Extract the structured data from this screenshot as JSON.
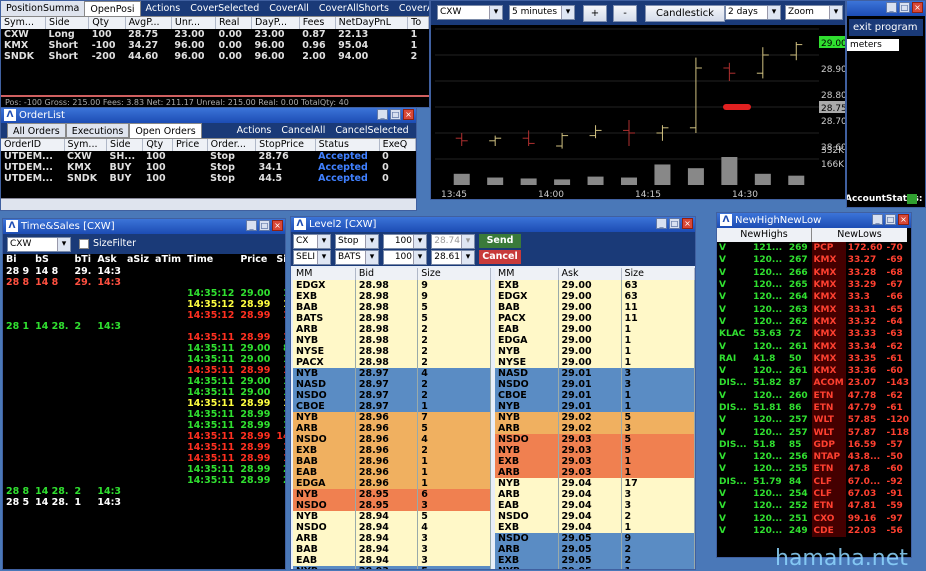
{
  "position": {
    "tabs": [
      "PositionSumma",
      "OpenPosi",
      "Actions",
      "CoverSelected",
      "CoverAll",
      "CoverAllShorts",
      "CoverAllLongs"
    ],
    "headers": [
      "Sym...",
      "Side",
      "Qty",
      "AvgP...",
      "Unr...",
      "Real",
      "DayP...",
      "Fees",
      "NetDayPnL",
      "To"
    ],
    "rows": [
      [
        "CXW",
        "Long",
        "100",
        "28.75",
        "23.00",
        "0.00",
        "23.00",
        "0.87",
        "22.13",
        "1"
      ],
      [
        "KMX",
        "Short",
        "-100",
        "34.27",
        "96.00",
        "0.00",
        "96.00",
        "0.96",
        "95.04",
        "1"
      ],
      [
        "SNDK",
        "Short",
        "-200",
        "44.60",
        "96.00",
        "0.00",
        "96.00",
        "2.00",
        "94.00",
        "2"
      ]
    ],
    "footer": "Pos:   -100  Gross:  215.00  Fees:   3.83   Net:  211.17   Unreal:  215.00   Real:   0.00   TotalQty:   40"
  },
  "orders": {
    "title": "OrderList",
    "tabs": [
      "All Orders",
      "Executions",
      "Open Orders",
      "Actions",
      "CancelAll",
      "CancelSelected"
    ],
    "headers": [
      "OrderID",
      "Sym...",
      "Side",
      "Qty",
      "Price",
      "Order...",
      "StopPrice",
      "Status",
      "ExeQ"
    ],
    "rows": [
      [
        "UTDEM...",
        "CXW",
        "SH...",
        "100",
        "",
        "Stop",
        "28.76",
        "Accepted",
        "0"
      ],
      [
        "UTDEM...",
        "KMX",
        "BUY",
        "100",
        "",
        "Stop",
        "34.1",
        "Accepted",
        "0"
      ],
      [
        "UTDEM...",
        "SNDK",
        "BUY",
        "100",
        "",
        "Stop",
        "44.5",
        "Accepted",
        "0"
      ]
    ]
  },
  "chart": {
    "symbol": "CXW",
    "interval": "5 minutes",
    "style": "Candlestick",
    "range": "2 days",
    "zoom": "Zoom",
    "plus": "+",
    "minus": "-",
    "y_labels": [
      "29.00",
      "28.90",
      "28.80",
      "28.75",
      "28.70",
      "28.60",
      "332K",
      "166K"
    ],
    "x_labels": [
      "13:45",
      "14:00",
      "14:15",
      "14:30"
    ]
  },
  "chart_data": {
    "type": "candlestick",
    "x": [
      "13:45",
      "13:50",
      "13:55",
      "14:00",
      "14:05",
      "14:10",
      "14:15",
      "14:20",
      "14:25",
      "14:30",
      "14:35"
    ],
    "ylim": [
      28.55,
      29.05
    ],
    "ohlc": [
      [
        28.63,
        28.65,
        28.6,
        28.62
      ],
      [
        28.62,
        28.64,
        28.6,
        28.63
      ],
      [
        28.63,
        28.66,
        28.6,
        28.61
      ],
      [
        28.6,
        28.65,
        28.59,
        28.64
      ],
      [
        28.64,
        28.68,
        28.63,
        28.66
      ],
      [
        28.66,
        28.7,
        28.6,
        28.65
      ],
      [
        28.65,
        28.68,
        28.62,
        28.67
      ],
      [
        28.67,
        28.94,
        28.65,
        28.9
      ],
      [
        28.9,
        28.92,
        28.85,
        28.88
      ],
      [
        28.88,
        28.98,
        28.86,
        28.95
      ],
      [
        28.95,
        29.0,
        28.93,
        28.99
      ]
    ],
    "volume": [
      60,
      40,
      35,
      30,
      45,
      40,
      110,
      90,
      150,
      60,
      50
    ]
  },
  "exitp": {
    "title": "exit program",
    "meters": "meters",
    "status": "AccountStatus:"
  },
  "ts": {
    "title": "Time&Sales [CXW]",
    "symbol": "CXW",
    "sizefilter": "SizeFilter",
    "headers": [
      "Bi",
      "bS",
      "bTi",
      "Ask",
      "aSiz",
      "aTim",
      "Time",
      "Price",
      "Size"
    ],
    "quote1": [
      "28 9",
      "14 8",
      "29.",
      "14:3"
    ],
    "quote1b": [
      "28 8",
      "14 8",
      "29.",
      "14:3"
    ],
    "trades": [
      [
        "14:35:12",
        "29.00",
        "100",
        "g"
      ],
      [
        "14:35:12",
        "28.99",
        "100",
        "y"
      ],
      [
        "14:35:12",
        "28.99",
        "100",
        "r"
      ],
      [
        "14:35:11",
        "28.99",
        "100",
        "r"
      ],
      [
        "14:35:11",
        "29.00",
        "800",
        "g"
      ],
      [
        "14:35:11",
        "29.00",
        "100",
        "g"
      ],
      [
        "14:35:11",
        "28.99",
        "100",
        "r"
      ],
      [
        "14:35:11",
        "29.00",
        "100",
        "g"
      ],
      [
        "14:35:11",
        "29.00",
        "100",
        "g"
      ],
      [
        "14:35:11",
        "28.99",
        "100",
        "y"
      ],
      [
        "14:35:11",
        "28.99",
        "100",
        "g"
      ],
      [
        "14:35:11",
        "28.99",
        "100",
        "g"
      ],
      [
        "14:35:11",
        "28.99",
        "1400",
        "r"
      ],
      [
        "14:35:11",
        "28.99",
        "100",
        "r"
      ],
      [
        "14:35:11",
        "28.99",
        "100",
        "r"
      ],
      [
        "14:35:11",
        "28.99",
        "200",
        "g"
      ],
      [
        "14:35:11",
        "28.99",
        "200",
        "g"
      ]
    ],
    "quote2": [
      "28 1",
      "14 28.",
      "2",
      "14:3"
    ],
    "quote3": [
      "28 8",
      "14 28.",
      "2",
      "14:3"
    ],
    "quote4": [
      "28 5",
      "14 28.",
      "1",
      "14:3"
    ]
  },
  "l2": {
    "title": "Level2 [CXW]",
    "sym": "CX",
    "type": "Stop",
    "qty1": "100",
    "price1": "28.74",
    "send": "Send",
    "side": "SELI",
    "route": "BATS",
    "qty2": "100",
    "price2": "28.61",
    "cancel": "Cancel",
    "bhdr": [
      "MM",
      "Bid",
      "Size"
    ],
    "ahdr": [
      "MM",
      "Ask",
      "Size"
    ],
    "bids": [
      [
        "EDGX",
        "28.98",
        "9"
      ],
      [
        "EXB",
        "28.98",
        "9"
      ],
      [
        "BAB",
        "28.98",
        "5"
      ],
      [
        "BATS",
        "28.98",
        "5"
      ],
      [
        "ARB",
        "28.98",
        "2"
      ],
      [
        "NYB",
        "28.98",
        "2"
      ],
      [
        "NYSE",
        "28.98",
        "2"
      ],
      [
        "PACX",
        "28.98",
        "2"
      ],
      [
        "NYB",
        "28.97",
        "4"
      ],
      [
        "NASD",
        "28.97",
        "2"
      ],
      [
        "NSDO",
        "28.97",
        "2"
      ],
      [
        "CBOE",
        "28.97",
        "1"
      ],
      [
        "NYB",
        "28.96",
        "7"
      ],
      [
        "ARB",
        "28.96",
        "5"
      ],
      [
        "NSDO",
        "28.96",
        "4"
      ],
      [
        "EXB",
        "28.96",
        "2"
      ],
      [
        "BAB",
        "28.96",
        "1"
      ],
      [
        "EAB",
        "28.96",
        "1"
      ],
      [
        "EDGA",
        "28.96",
        "1"
      ],
      [
        "NYB",
        "28.95",
        "6"
      ],
      [
        "NSDO",
        "28.95",
        "3"
      ],
      [
        "NYB",
        "28.94",
        "5"
      ],
      [
        "NSDO",
        "28.94",
        "4"
      ],
      [
        "ARB",
        "28.94",
        "3"
      ],
      [
        "BAB",
        "28.94",
        "3"
      ],
      [
        "EAB",
        "28.94",
        "3"
      ],
      [
        "NYB",
        "28.93",
        "5"
      ]
    ],
    "asks": [
      [
        "EXB",
        "29.00",
        "63"
      ],
      [
        "EDGX",
        "29.00",
        "63"
      ],
      [
        "BAB",
        "29.00",
        "11"
      ],
      [
        "PACX",
        "29.00",
        "11"
      ],
      [
        "EAB",
        "29.00",
        "1"
      ],
      [
        "EDGA",
        "29.00",
        "1"
      ],
      [
        "NYB",
        "29.00",
        "1"
      ],
      [
        "NYSE",
        "29.00",
        "1"
      ],
      [
        "NASD",
        "29.01",
        "3"
      ],
      [
        "NSDO",
        "29.01",
        "3"
      ],
      [
        "CBOE",
        "29.01",
        "1"
      ],
      [
        "NYB",
        "29.01",
        "1"
      ],
      [
        "NYB",
        "29.02",
        "5"
      ],
      [
        "ARB",
        "29.02",
        "3"
      ],
      [
        "NSDO",
        "29.03",
        "5"
      ],
      [
        "NYB",
        "29.03",
        "5"
      ],
      [
        "EXB",
        "29.03",
        "1"
      ],
      [
        "ARB",
        "29.03",
        "1"
      ],
      [
        "NYB",
        "29.04",
        "17"
      ],
      [
        "ARB",
        "29.04",
        "3"
      ],
      [
        "EAB",
        "29.04",
        "3"
      ],
      [
        "NSDO",
        "29.04",
        "2"
      ],
      [
        "EXB",
        "29.04",
        "1"
      ],
      [
        "NSDO",
        "29.05",
        "9"
      ],
      [
        "ARB",
        "29.05",
        "2"
      ],
      [
        "EXB",
        "29.05",
        "2"
      ],
      [
        "NYB",
        "29.05",
        "1"
      ]
    ],
    "bcolors": [
      "y",
      "y",
      "y",
      "y",
      "y",
      "y",
      "y",
      "y",
      "b",
      "b",
      "b",
      "b",
      "o",
      "o",
      "o",
      "o",
      "o",
      "o",
      "o",
      "r",
      "r",
      "y",
      "y",
      "y",
      "y",
      "y",
      "b"
    ],
    "acolors": [
      "y",
      "y",
      "y",
      "y",
      "y",
      "y",
      "y",
      "y",
      "b",
      "b",
      "b",
      "b",
      "o",
      "o",
      "r",
      "r",
      "r",
      "r",
      "y",
      "y",
      "y",
      "y",
      "y",
      "b",
      "b",
      "b",
      "b"
    ]
  },
  "nh": {
    "title": "NewHighNewLow",
    "hdr_high": "NewHighs",
    "hdr_low": "NewLows",
    "highs": [
      [
        "V",
        "121...",
        "269"
      ],
      [
        "V",
        "120...",
        "267"
      ],
      [
        "V",
        "120...",
        "266"
      ],
      [
        "V",
        "120...",
        "265"
      ],
      [
        "V",
        "120...",
        "264"
      ],
      [
        "V",
        "120...",
        "263"
      ],
      [
        "V",
        "120...",
        "262"
      ],
      [
        "KLAC",
        "53.63",
        "72"
      ],
      [
        "V",
        "120...",
        "261"
      ],
      [
        "RAI",
        "41.8",
        "50"
      ],
      [
        "V",
        "120...",
        "261"
      ],
      [
        "DIS...",
        "51.82",
        "87"
      ],
      [
        "V",
        "120...",
        "260"
      ],
      [
        "DIS...",
        "51.81",
        "86"
      ],
      [
        "V",
        "120...",
        "257"
      ],
      [
        "V",
        "120...",
        "257"
      ],
      [
        "DIS...",
        "51.8",
        "85"
      ],
      [
        "V",
        "120...",
        "256"
      ],
      [
        "V",
        "120...",
        "255"
      ],
      [
        "DIS...",
        "51.79",
        "84"
      ],
      [
        "V",
        "120...",
        "254"
      ],
      [
        "V",
        "120...",
        "252"
      ],
      [
        "V",
        "120...",
        "251"
      ],
      [
        "V",
        "120...",
        "249"
      ]
    ],
    "lows": [
      [
        "PCP",
        "172.60",
        "-70"
      ],
      [
        "KMX",
        "33.27",
        "-69"
      ],
      [
        "KMX",
        "33.28",
        "-68"
      ],
      [
        "KMX",
        "33.29",
        "-67"
      ],
      [
        "KMX",
        "33.3",
        "-66"
      ],
      [
        "KMX",
        "33.31",
        "-65"
      ],
      [
        "KMX",
        "33.32",
        "-64"
      ],
      [
        "KMX",
        "33.33",
        "-63"
      ],
      [
        "KMX",
        "33.34",
        "-62"
      ],
      [
        "KMX",
        "33.35",
        "-61"
      ],
      [
        "KMX",
        "33.36",
        "-60"
      ],
      [
        "ACOM",
        "23.07",
        "-143"
      ],
      [
        "ETN",
        "47.78",
        "-62"
      ],
      [
        "ETN",
        "47.79",
        "-61"
      ],
      [
        "WLT",
        "57.85",
        "-120"
      ],
      [
        "WLT",
        "57.87",
        "-118"
      ],
      [
        "GDP",
        "16.59",
        "-57"
      ],
      [
        "NTAP",
        "43.8...",
        "-50"
      ],
      [
        "ETN",
        "47.8",
        "-60"
      ],
      [
        "CLF",
        "67.0...",
        "-92"
      ],
      [
        "CLF",
        "67.03",
        "-91"
      ],
      [
        "ETN",
        "47.81",
        "-59"
      ],
      [
        "CXO",
        "99.16",
        "-97"
      ],
      [
        "CDE",
        "22.03",
        "-56"
      ]
    ]
  },
  "watermark": "hamaha.net",
  "colors": {
    "titlebar": "#1c4cb4",
    "bg": "#4a78b8",
    "yellow": "#fff8c8",
    "blue": "#5a8cc4",
    "orange": "#f0b060",
    "red": "#f08050"
  }
}
